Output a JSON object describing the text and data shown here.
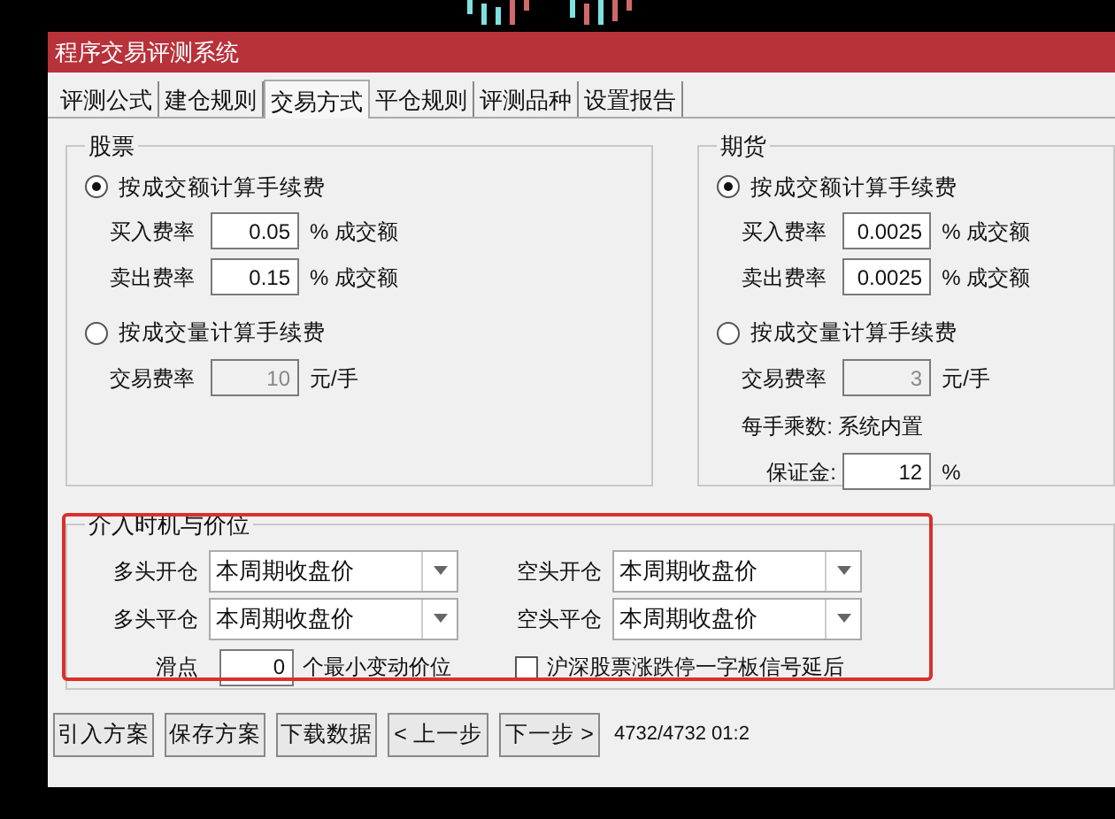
{
  "window": {
    "title": "程序交易评测系统"
  },
  "tabs": [
    {
      "label": "评测公式",
      "selected": false
    },
    {
      "label": "建仓规则",
      "selected": false
    },
    {
      "label": "交易方式",
      "selected": true
    },
    {
      "label": "平仓规则",
      "selected": false
    },
    {
      "label": "评测品种",
      "selected": false
    },
    {
      "label": "设置报告",
      "selected": false
    }
  ],
  "stock": {
    "title": "股票",
    "modes": [
      {
        "label": "按成交额计算手续费",
        "selected": true,
        "rows": [
          {
            "label": "买入费率",
            "value": "0.05",
            "unit": "% 成交额",
            "disabled": false
          },
          {
            "label": "卖出费率",
            "value": "0.15",
            "unit": "% 成交额",
            "disabled": false
          }
        ]
      },
      {
        "label": "按成交量计算手续费",
        "selected": false,
        "rows": [
          {
            "label": "交易费率",
            "value": "10",
            "unit": "元/手",
            "disabled": true
          }
        ]
      }
    ]
  },
  "futures": {
    "title": "期货",
    "modes": [
      {
        "label": "按成交额计算手续费",
        "selected": true,
        "rows": [
          {
            "label": "买入费率",
            "value": "0.0025",
            "unit": "% 成交额",
            "disabled": false
          },
          {
            "label": "卖出费率",
            "value": "0.0025",
            "unit": "% 成交额",
            "disabled": false
          }
        ]
      },
      {
        "label": "按成交量计算手续费",
        "selected": false,
        "rows": [
          {
            "label": "交易费率",
            "value": "3",
            "unit": "元/手",
            "disabled": true
          }
        ]
      }
    ],
    "multiplier": "每手乘数: 系统内置",
    "margin": {
      "label": "保证金:",
      "value": "12",
      "unit": "%"
    }
  },
  "entry": {
    "title": "介入时机与价位",
    "selects": [
      {
        "label": "多头开仓",
        "value": "本周期收盘价"
      },
      {
        "label": "空头开仓",
        "value": "本周期收盘价"
      },
      {
        "label": "多头平仓",
        "value": "本周期收盘价"
      },
      {
        "label": "空头平仓",
        "value": "本周期收盘价"
      }
    ],
    "slippage": {
      "label": "滑点",
      "value": "0",
      "unit": "个最小变动价位"
    },
    "checkbox": {
      "label": "沪深股票涨跌停一字板信号延后",
      "checked": false
    }
  },
  "buttons": [
    "引入方案",
    "保存方案",
    "下载数据",
    "< 上一步",
    "下一步 >"
  ],
  "status": "4732/4732 01:2"
}
